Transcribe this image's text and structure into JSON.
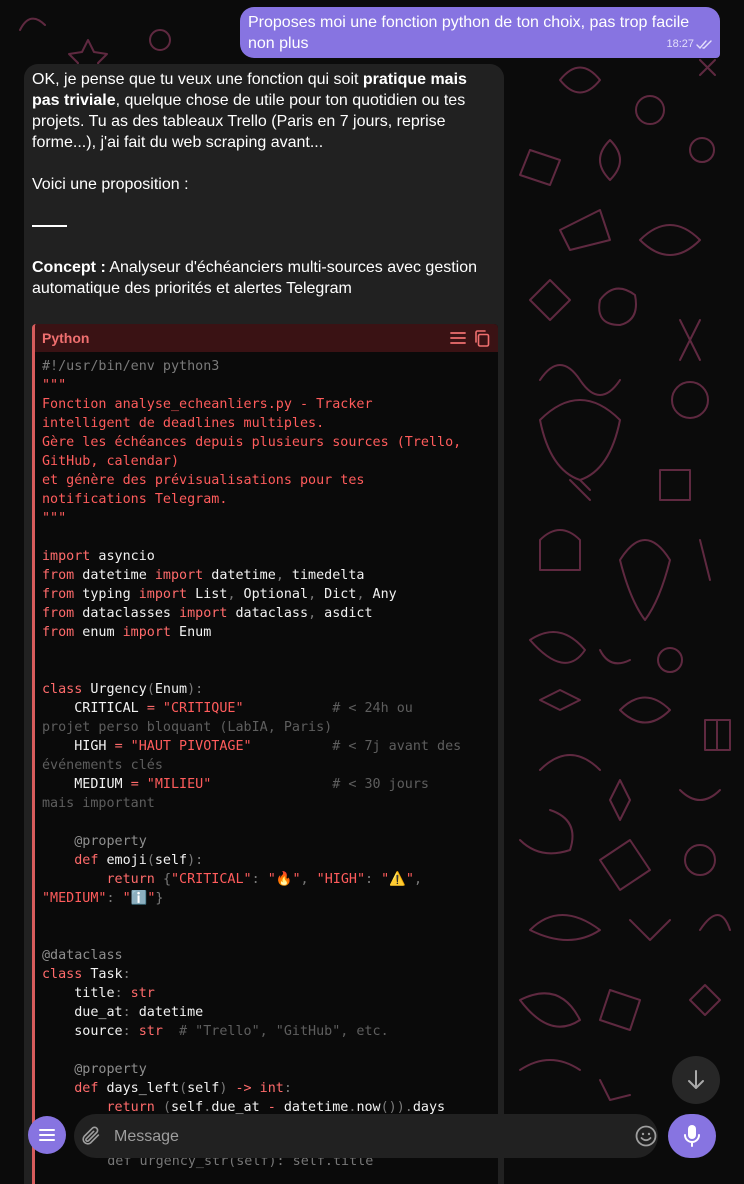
{
  "outgoing_message": {
    "text": "Proposes moi une fonction python de ton choix, pas trop facile non plus",
    "time": "18:27",
    "status_icon": "double-check-icon"
  },
  "incoming_message": {
    "intro_part1": "OK, je pense que tu veux une fonction qui soit ",
    "intro_bold": "pratique mais pas triviale",
    "intro_part2": ", quelque chose de utile pour ton quotidien ou tes projets. Tu as des tableaux Trello (Paris en 7 jours, reprise forme...), j'ai fait du web scraping avant...",
    "proposal_line": "Voici une proposition :",
    "concept_label": "Concept :",
    "concept_text": " Analyseur d'échéanciers multi-sources avec gestion automatique des priorités et alertes Telegram"
  },
  "code_block": {
    "language": "Python",
    "accent_color": "#d65c5c",
    "actions": [
      "wrap-lines-icon",
      "copy-icon"
    ]
  },
  "code_lines": [
    [
      [
        "p",
        "#!/usr/bin/env python3"
      ]
    ],
    [
      [
        "s",
        "\"\"\""
      ]
    ],
    [
      [
        "s",
        "Fonction analyse_echeanliers.py - Tracker"
      ]
    ],
    [
      [
        "s",
        "intelligent de deadlines multiples."
      ]
    ],
    [
      [
        "s",
        "Gère les échéances depuis plusieurs sources (Trello,"
      ]
    ],
    [
      [
        "s",
        "GitHub, calendar)"
      ]
    ],
    [
      [
        "s",
        "et génère des prévisualisations pour tes"
      ]
    ],
    [
      [
        "s",
        "notifications Telegram."
      ]
    ],
    [
      [
        "s",
        "\"\"\""
      ]
    ],
    [],
    [
      [
        "k",
        "import"
      ],
      [
        "t",
        " asyncio"
      ]
    ],
    [
      [
        "k",
        "from"
      ],
      [
        "t",
        " datetime "
      ],
      [
        "k",
        "import"
      ],
      [
        "t",
        " datetime"
      ],
      [
        "p",
        ","
      ],
      [
        "t",
        " timedelta"
      ]
    ],
    [
      [
        "k",
        "from"
      ],
      [
        "t",
        " typing "
      ],
      [
        "k",
        "import"
      ],
      [
        "t",
        " List"
      ],
      [
        "p",
        ","
      ],
      [
        "t",
        " Optional"
      ],
      [
        "p",
        ","
      ],
      [
        "t",
        " Dict"
      ],
      [
        "p",
        ","
      ],
      [
        "t",
        " Any"
      ]
    ],
    [
      [
        "k",
        "from"
      ],
      [
        "t",
        " dataclasses "
      ],
      [
        "k",
        "import"
      ],
      [
        "t",
        " dataclass"
      ],
      [
        "p",
        ","
      ],
      [
        "t",
        " asdict"
      ]
    ],
    [
      [
        "k",
        "from"
      ],
      [
        "t",
        " enum "
      ],
      [
        "k",
        "import"
      ],
      [
        "t",
        " Enum"
      ]
    ],
    [],
    [],
    [
      [
        "k",
        "class"
      ],
      [
        "t",
        " Urgency"
      ],
      [
        "p",
        "("
      ],
      [
        "t",
        "Enum"
      ],
      [
        "p",
        "):"
      ]
    ],
    [
      [
        "t",
        "    CRITICAL "
      ],
      [
        "k",
        "="
      ],
      [
        "s",
        " \"CRITIQUE\""
      ],
      [
        "c",
        "           # < 24h ou"
      ]
    ],
    [
      [
        "c",
        "projet perso bloquant (LabIA, Paris)"
      ]
    ],
    [
      [
        "t",
        "    HIGH "
      ],
      [
        "k",
        "="
      ],
      [
        "s",
        " \"HAUT PIVOTAGE\""
      ],
      [
        "c",
        "          # < 7j avant des"
      ]
    ],
    [
      [
        "c",
        "événements clés"
      ]
    ],
    [
      [
        "t",
        "    MEDIUM "
      ],
      [
        "k",
        "="
      ],
      [
        "s",
        " \"MILIEU\""
      ],
      [
        "c",
        "               # < 30 jours"
      ]
    ],
    [
      [
        "c",
        "mais important"
      ]
    ],
    [],
    [
      [
        "d",
        "    @property"
      ]
    ],
    [
      [
        "k",
        "    def"
      ],
      [
        "t",
        " emoji"
      ],
      [
        "p",
        "("
      ],
      [
        "t",
        "self"
      ],
      [
        "p",
        "):"
      ]
    ],
    [
      [
        "k",
        "        return"
      ],
      [
        "t",
        " "
      ],
      [
        "p",
        "{"
      ],
      [
        "s",
        "\"CRITICAL\""
      ],
      [
        "p",
        ":"
      ],
      [
        "t",
        " "
      ],
      [
        "s",
        "\"🔥\""
      ],
      [
        "p",
        ","
      ],
      [
        "t",
        " "
      ],
      [
        "s",
        "\"HIGH\""
      ],
      [
        "p",
        ":"
      ],
      [
        "t",
        " "
      ],
      [
        "s",
        "\"⚠️\""
      ],
      [
        "p",
        ","
      ]
    ],
    [
      [
        "s",
        "\"MEDIUM\""
      ],
      [
        "p",
        ":"
      ],
      [
        "t",
        " "
      ],
      [
        "s",
        "\"ℹ️\""
      ],
      [
        "p",
        "}"
      ]
    ],
    [],
    [],
    [
      [
        "d",
        "@dataclass"
      ]
    ],
    [
      [
        "k",
        "class"
      ],
      [
        "t",
        " Task"
      ],
      [
        "p",
        ":"
      ]
    ],
    [
      [
        "t",
        "    title"
      ],
      [
        "p",
        ":"
      ],
      [
        "k",
        " str"
      ]
    ],
    [
      [
        "t",
        "    due_at"
      ],
      [
        "p",
        ":"
      ],
      [
        "t",
        " datetime"
      ]
    ],
    [
      [
        "t",
        "    source"
      ],
      [
        "p",
        ":"
      ],
      [
        "k",
        " str"
      ],
      [
        "c",
        "  # \"Trello\", \"GitHub\", etc."
      ]
    ],
    [],
    [
      [
        "d",
        "    @property"
      ]
    ],
    [
      [
        "k",
        "    def"
      ],
      [
        "t",
        " days_left"
      ],
      [
        "p",
        "("
      ],
      [
        "t",
        "self"
      ],
      [
        "p",
        ")"
      ],
      [
        "k",
        " ->"
      ],
      [
        "k",
        " int"
      ],
      [
        "p",
        ":"
      ]
    ],
    [
      [
        "k",
        "        return"
      ],
      [
        "t",
        " "
      ],
      [
        "p",
        "("
      ],
      [
        "t",
        "self"
      ],
      [
        "p",
        "."
      ],
      [
        "t",
        "due_at "
      ],
      [
        "k",
        "-"
      ],
      [
        "t",
        " datetime"
      ],
      [
        "p",
        "."
      ],
      [
        "t",
        "now"
      ],
      [
        "p",
        "())."
      ],
      [
        "t",
        "days"
      ]
    ]
  ],
  "composer": {
    "placeholder": "Message",
    "peek_text": "    def urgency_str(self): self.title"
  }
}
